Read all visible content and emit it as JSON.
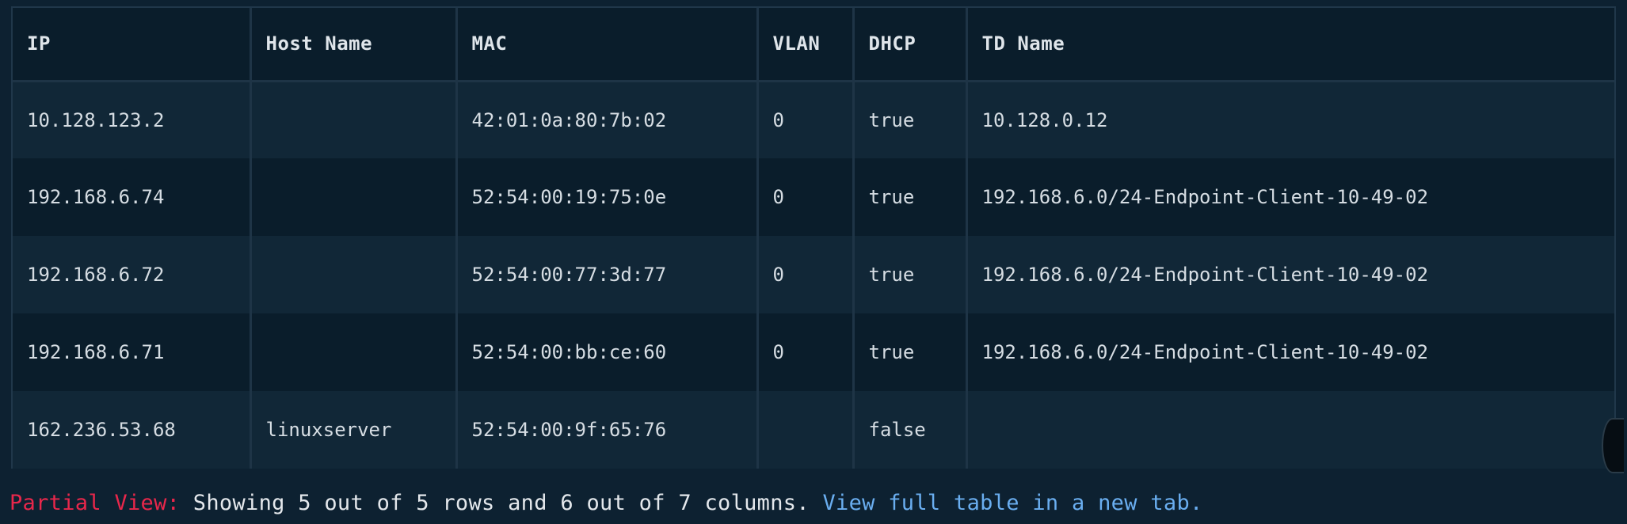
{
  "table": {
    "columns": [
      "IP",
      "Host Name",
      "MAC",
      "VLAN",
      "DHCP",
      "TD Name"
    ],
    "rows": [
      [
        "10.128.123.2",
        "",
        "42:01:0a:80:7b:02",
        "0",
        "true",
        "10.128.0.12"
      ],
      [
        "192.168.6.74",
        "",
        "52:54:00:19:75:0e",
        "0",
        "true",
        "192.168.6.0/24-Endpoint-Client-10-49-02"
      ],
      [
        "192.168.6.72",
        "",
        "52:54:00:77:3d:77",
        "0",
        "true",
        "192.168.6.0/24-Endpoint-Client-10-49-02"
      ],
      [
        "192.168.6.71",
        "",
        "52:54:00:bb:ce:60",
        "0",
        "true",
        "192.168.6.0/24-Endpoint-Client-10-49-02"
      ],
      [
        "162.236.53.68",
        "linuxserver",
        "52:54:00:9f:65:76",
        "",
        "false",
        ""
      ]
    ]
  },
  "footer": {
    "partial_label": "Partial View:",
    "showing_text": "Showing 5 out of 5 rows and 6 out of 7 columns.",
    "link_text": "View full table in a new tab."
  },
  "colors": {
    "background": "#0d2131",
    "partial_label": "#e8274b",
    "link": "#6aaef0"
  }
}
